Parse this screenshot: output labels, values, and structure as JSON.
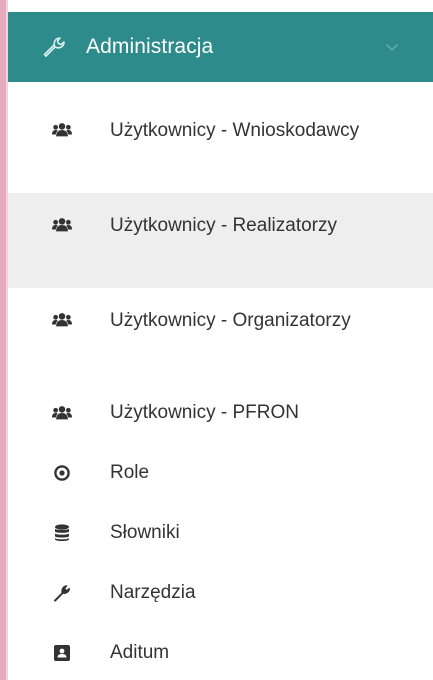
{
  "section": {
    "title": "Administracja",
    "header_icon": "wrench-outline-icon",
    "toggle_icon": "chevron-down-icon",
    "colors": {
      "header_bg": "#2e8b8b",
      "active_bg": "#eeeeee",
      "accent_rule": "#e7a9bd"
    }
  },
  "menu": {
    "items": [
      {
        "label": "Użytkownicy - Wnioskodawcy",
        "icon": "users-icon"
      },
      {
        "label": "Użytkownicy - Realizatorzy",
        "icon": "users-icon",
        "active": true
      },
      {
        "label": "Użytkownicy - Organizatorzy",
        "icon": "users-icon"
      },
      {
        "label": "Użytkownicy - PFRON",
        "icon": "users-icon"
      },
      {
        "label": "Role",
        "icon": "dot-circle-icon"
      },
      {
        "label": "Słowniki",
        "icon": "database-icon"
      },
      {
        "label": "Narzędzia",
        "icon": "wrench-icon"
      },
      {
        "label": "Aditum",
        "icon": "contact-card-icon"
      }
    ]
  }
}
